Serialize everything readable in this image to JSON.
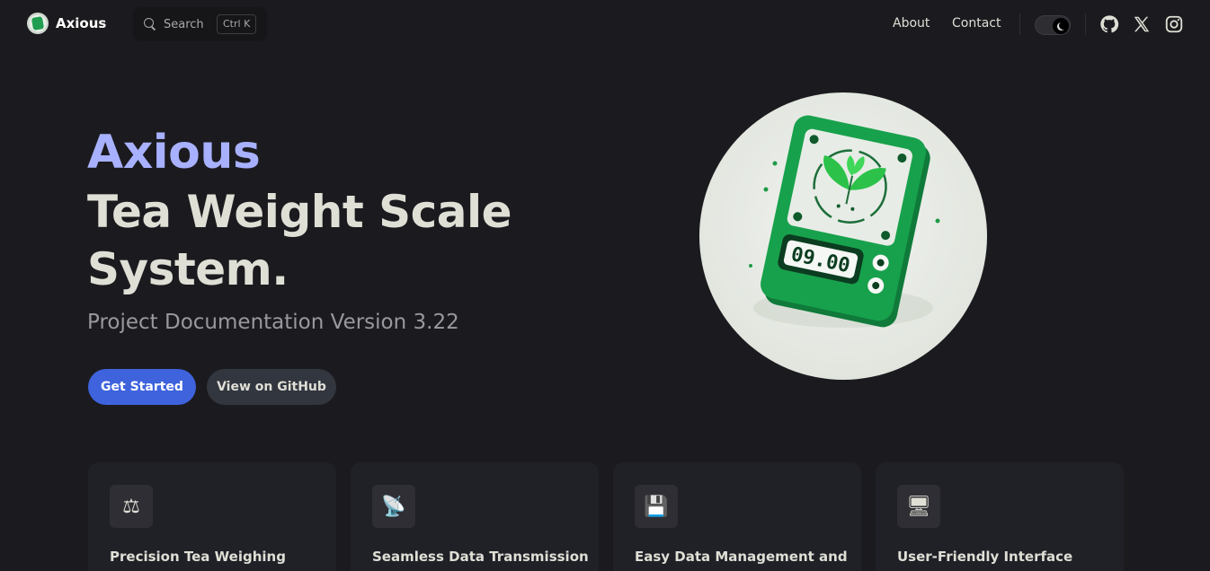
{
  "nav": {
    "brand": "Axious",
    "search": {
      "label": "Search",
      "shortcut": "Ctrl K"
    },
    "links": [
      "About",
      "Contact"
    ],
    "theme_toggle": "dark",
    "social": [
      "github-icon",
      "x-icon",
      "instagram-icon"
    ]
  },
  "hero": {
    "name": "Axious",
    "title": "Tea Weight Scale System.",
    "tagline": "Project Documentation Version 3.22",
    "actions": {
      "primary": "Get Started",
      "secondary": "View on GitHub"
    },
    "image": {
      "display_reading": "09.00"
    }
  },
  "features": [
    {
      "icon": "scale-icon",
      "glyph": "⚖",
      "title": "Precision Tea Weighing"
    },
    {
      "icon": "satellite-dish-icon",
      "glyph": "📡",
      "title": "Seamless Data Transmission"
    },
    {
      "icon": "floppy-disk-icon",
      "glyph": "💾",
      "title": "Easy Data Management and"
    },
    {
      "icon": "monitor-icon",
      "glyph": "🖥",
      "title": "User-Friendly Interface"
    }
  ],
  "colors": {
    "background": "#1b1b1f",
    "brand_accent": "#a8b1ff",
    "primary_button": "#3e63dd",
    "card": "#202127"
  }
}
